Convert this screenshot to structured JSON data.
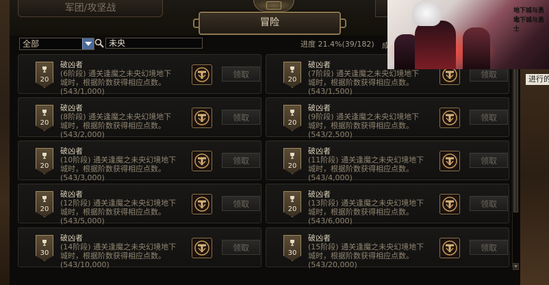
{
  "tabs": {
    "guild": "军团/攻坚战",
    "adventure": "冒险"
  },
  "background": {
    "right_text": "进行的"
  },
  "filter": {
    "selected": "全部"
  },
  "search": {
    "value": "未央"
  },
  "progress": {
    "text": "进度 21.4%(39/182)",
    "percent": 21.4,
    "done": 39,
    "total": 182,
    "overflow_label": "成"
  },
  "claim_label": "领取",
  "cards": [
    {
      "title": "破凶者",
      "stage": "(6阶段) 通关逢魔之未央幻境地下",
      "desc2": "城时，根据阶数获得相应点数。",
      "count": "(543/1,000)",
      "points": "20"
    },
    {
      "title": "破凶者",
      "stage": "(7阶段) 通关逢魔之未央幻境地下",
      "desc2": "城时，根据阶数获得相应点数。",
      "count": "(543/1,500)",
      "points": "20"
    },
    {
      "title": "破凶者",
      "stage": "(8阶段) 通关逢魔之未央幻境地下",
      "desc2": "城时，根据阶数获得相应点数。",
      "count": "(543/2,000)",
      "points": "20"
    },
    {
      "title": "破凶者",
      "stage": "(9阶段) 通关逢魔之未央幻境地下",
      "desc2": "城时，根据阶数获得相应点数。",
      "count": "(543/2,500)",
      "points": "20"
    },
    {
      "title": "破凶者",
      "stage": "(10阶段) 通关逢魔之未央幻境地下",
      "desc2": "城时，根据阶数获得相应点数。",
      "count": "(543/3,000)",
      "points": "20"
    },
    {
      "title": "破凶者",
      "stage": "(11阶段) 通关逢魔之未央幻境地下",
      "desc2": "城时，根据阶数获得相应点数。",
      "count": "(543/4,000)",
      "points": "20"
    },
    {
      "title": "破凶者",
      "stage": "(12阶段) 通关逢魔之未央幻境地下",
      "desc2": "城时，根据阶数获得相应点数。",
      "count": "(543/5,000)",
      "points": "20"
    },
    {
      "title": "破凶者",
      "stage": "(13阶段) 通关逢魔之未央幻境地下",
      "desc2": "城时，根据阶数获得相应点数。",
      "count": "(543/6,000)",
      "points": "20"
    },
    {
      "title": "破凶者",
      "stage": "(14阶段) 通关逢魔之未央幻境地下",
      "desc2": "城时，根据阶数获得相应点数。",
      "count": "(543/10,000)",
      "points": "30"
    },
    {
      "title": "破凶者",
      "stage": "(15阶段) 通关逢魔之未央幻境地下",
      "desc2": "城时，根据阶数获得相应点数。",
      "count": "(543/20,000)",
      "points": "30"
    }
  ],
  "promo": {
    "logo_line1": "地下城与勇士",
    "logo_line2": "地下城与勇士"
  },
  "icons": {
    "search": "search-icon",
    "dropdown": "chevron-down-icon",
    "trophy": "trophy-icon",
    "reward": "reward-box-icon"
  },
  "colors": {
    "accent_gold": "#8a7550",
    "dropdown_blue": "#4b6a9a"
  }
}
